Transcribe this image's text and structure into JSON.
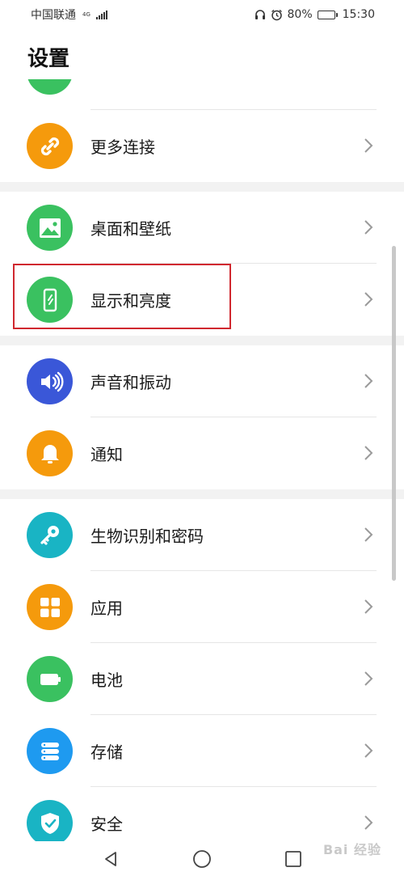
{
  "status": {
    "carrier": "中国联通",
    "network_type": "4G",
    "battery_level": "80%",
    "battery_fraction": 0.8,
    "time": "15:30"
  },
  "header": {
    "title": "设置"
  },
  "items": {
    "more_connections": {
      "label": "更多连接",
      "icon": "link-icon",
      "color": "#f59a0c"
    },
    "desktop_wallpaper": {
      "label": "桌面和壁纸",
      "icon": "image-icon",
      "color": "#3ac160"
    },
    "display_brightness": {
      "label": "显示和亮度",
      "icon": "phone-brightness-icon",
      "color": "#3ac160"
    },
    "sound_vibration": {
      "label": "声音和振动",
      "icon": "speaker-icon",
      "color": "#3a57d8"
    },
    "notifications": {
      "label": "通知",
      "icon": "bell-icon",
      "color": "#f59a0c"
    },
    "biometrics_password": {
      "label": "生物识别和密码",
      "icon": "key-icon",
      "color": "#19b4c4"
    },
    "apps": {
      "label": "应用",
      "icon": "apps-grid-icon",
      "color": "#f59a0c"
    },
    "battery": {
      "label": "电池",
      "icon": "battery-icon",
      "color": "#3ac160"
    },
    "storage": {
      "label": "存储",
      "icon": "storage-icon",
      "color": "#1e9af0"
    },
    "security": {
      "label": "安全",
      "icon": "shield-check-icon",
      "color": "#19b4c4"
    }
  },
  "watermark": {
    "text": "Bai 经验"
  },
  "accent": {
    "highlight_border": "#d0282f"
  }
}
